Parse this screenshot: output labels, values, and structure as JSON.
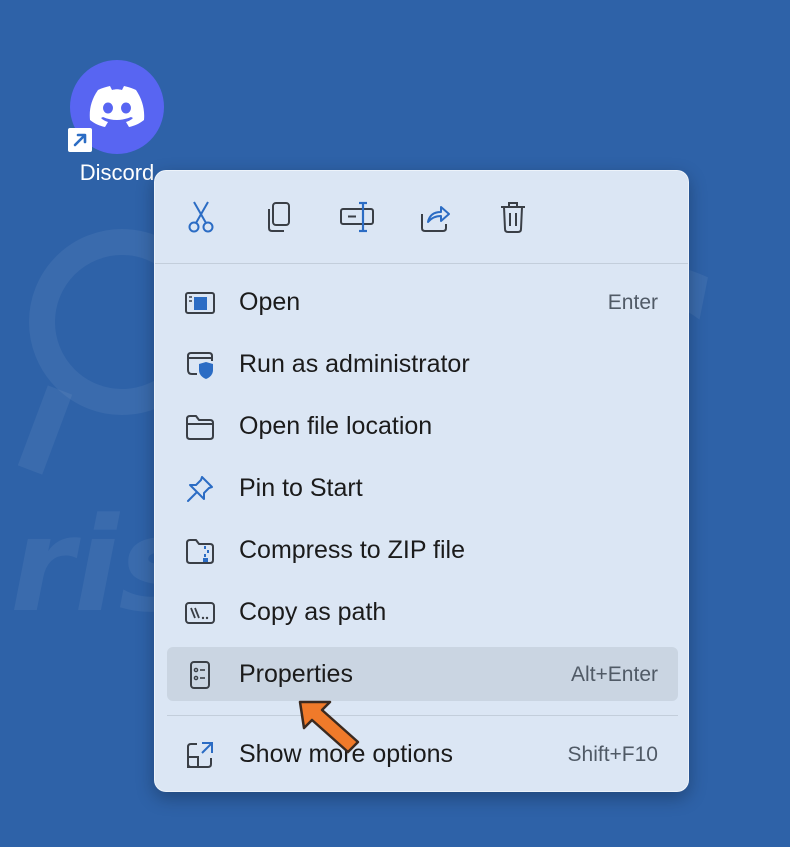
{
  "desktop": {
    "shortcut_label": "Discord",
    "shortcut_icon": "discord-logo-icon",
    "brand_color": "#5865f2"
  },
  "context_menu": {
    "toolbar": [
      {
        "id": "cut",
        "icon": "scissors-icon"
      },
      {
        "id": "copy",
        "icon": "copy-icon"
      },
      {
        "id": "rename",
        "icon": "rename-icon"
      },
      {
        "id": "share",
        "icon": "share-icon"
      },
      {
        "id": "delete",
        "icon": "trash-icon"
      }
    ],
    "items": [
      {
        "label": "Open",
        "shortcut": "Enter",
        "icon": "open-window-icon"
      },
      {
        "label": "Run as administrator",
        "shortcut": "",
        "icon": "shield-window-icon"
      },
      {
        "label": "Open file location",
        "shortcut": "",
        "icon": "folder-icon"
      },
      {
        "label": "Pin to Start",
        "shortcut": "",
        "icon": "pin-icon"
      },
      {
        "label": "Compress to ZIP file",
        "shortcut": "",
        "icon": "zip-folder-icon"
      },
      {
        "label": "Copy as path",
        "shortcut": "",
        "icon": "path-icon"
      },
      {
        "label": "Properties",
        "shortcut": "Alt+Enter",
        "icon": "properties-icon",
        "highlighted": true
      }
    ],
    "more_options": {
      "label": "Show more options",
      "shortcut": "Shift+F10",
      "icon": "expand-icon"
    }
  },
  "colors": {
    "desktop_bg": "#2e62a8",
    "menu_bg": "#dbe6f4",
    "highlight": "#cad5e2",
    "icon_blue": "#2b6cc4",
    "arrow": "#f07a2a"
  }
}
